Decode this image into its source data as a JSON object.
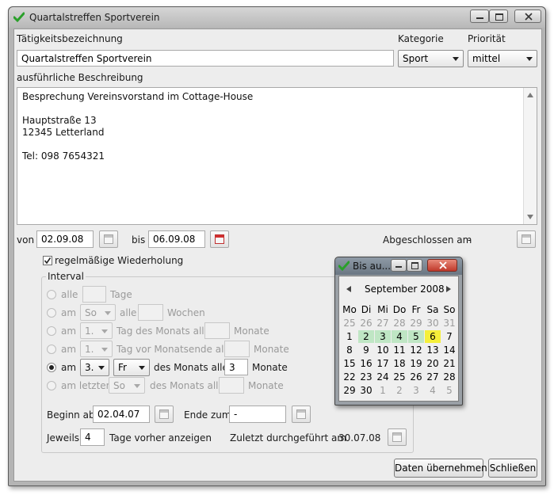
{
  "window": {
    "title": "Quartalstreffen Sportverein"
  },
  "form": {
    "activity_label": "Tätigkeitsbezeichnung",
    "activity_value": "Quartalstreffen Sportverein",
    "category_label": "Kategorie",
    "category_value": "Sport",
    "priority_label": "Priorität",
    "priority_value": "mittel",
    "description_label": "ausführliche Beschreibung",
    "description_lines": [
      "Besprechung Vereinsvorstand im Cottage-House",
      "",
      "Hauptstraße 13",
      "12345 Letterland",
      "",
      "Tel: 098 7654321"
    ],
    "from_label": "von",
    "from_value": "02.09.08",
    "to_label": "bis",
    "to_value": "06.09.08",
    "completed_label": "Abgeschlossen am",
    "completed_value": "-"
  },
  "recurrence": {
    "checkbox_label": "regelmäßige Wiederholung",
    "interval_label": "Interval",
    "row1": {
      "prefix": "alle",
      "value": "",
      "unit": "Tage"
    },
    "row2": {
      "prefix": "am",
      "combo": "So",
      "middle": "alle",
      "value": "",
      "unit": "Wochen"
    },
    "row3": {
      "prefix": "am",
      "combo": "1.",
      "middle": "Tag des Monats alle",
      "value": "",
      "unit": "Monate"
    },
    "row4": {
      "prefix": "am",
      "combo": "1.",
      "middle": "Tag vor Monatsende alle",
      "value": "",
      "unit": "Monate"
    },
    "row5": {
      "prefix": "am",
      "combo1": "3.",
      "combo2": "Fr",
      "middle": "des Monats alle",
      "value": "3",
      "unit": "Monate"
    },
    "row6": {
      "prefix": "am letzten",
      "combo": "So",
      "middle": "des Monats alle",
      "value": "",
      "unit": "Monate"
    },
    "begin_label": "Beginn ab",
    "begin_value": "02.04.07",
    "end_label": "Ende zum",
    "end_value": "-",
    "each_label": "Jeweils",
    "each_value": "4",
    "days_before_label": "Tage vorher anzeigen",
    "last_done_label": "Zuletzt durchgeführt am",
    "last_done_value": "30.07.08"
  },
  "buttons": {
    "apply": "Daten übernehmen",
    "close": "Schließen"
  },
  "calendar_popup": {
    "title": "Bis au...",
    "month": "September 2008",
    "weekdays": [
      "Mo",
      "Di",
      "Mi",
      "Do",
      "Fr",
      "Sa",
      "So"
    ],
    "weeks": [
      [
        "25",
        "26",
        "27",
        "28",
        "29",
        "30",
        "31"
      ],
      [
        "1",
        "2",
        "3",
        "4",
        "5",
        "6",
        "7"
      ],
      [
        "8",
        "9",
        "10",
        "11",
        "12",
        "13",
        "14"
      ],
      [
        "15",
        "16",
        "17",
        "18",
        "19",
        "20",
        "21"
      ],
      [
        "22",
        "23",
        "24",
        "25",
        "26",
        "27",
        "28"
      ],
      [
        "29",
        "30",
        "1",
        "2",
        "3",
        "4",
        "5"
      ]
    ]
  },
  "colors": {
    "range_highlight": "#bfe6c4",
    "selected_day": "#f5ef3a"
  }
}
